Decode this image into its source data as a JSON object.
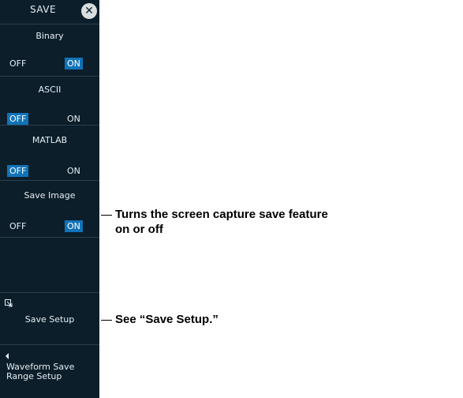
{
  "menu": {
    "title": "SAVE",
    "close_icon": "close-icon",
    "items": [
      {
        "label": "Binary",
        "off": "OFF",
        "on": "ON",
        "selected": "on"
      },
      {
        "label": "ASCII",
        "off": "OFF",
        "on": "ON",
        "selected": "off"
      },
      {
        "label": "MATLAB",
        "off": "OFF",
        "on": "ON",
        "selected": "off"
      },
      {
        "label": "Save Image",
        "off": "OFF",
        "on": "ON",
        "selected": "on"
      }
    ],
    "save_setup": {
      "label": "Save Setup",
      "icon": "setup-icon"
    },
    "range_setup": {
      "line1": "Waveform Save",
      "line2": "Range Setup",
      "icon": "left-arrow-icon"
    }
  },
  "callouts": {
    "save_image_line1": "Turns the screen capture save feature",
    "save_image_line2": "on or off",
    "save_setup": "See “Save Setup.”"
  },
  "colors": {
    "menu_bg": "#0b1e2a",
    "selected_bg": "#1173b8",
    "text": "#e6eef3"
  }
}
